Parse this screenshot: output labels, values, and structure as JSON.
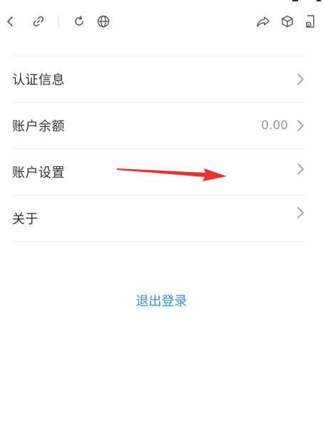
{
  "toolbar": {
    "icons": [
      "back-icon",
      "link-icon",
      "refresh-icon",
      "globe-icon",
      "share-icon",
      "cube-icon",
      "mobile-speaker-icon"
    ]
  },
  "menu": {
    "items": [
      {
        "label": "认证信息",
        "value": ""
      },
      {
        "label": "账户余额",
        "value": "0.00"
      },
      {
        "label": "账户设置",
        "value": ""
      },
      {
        "label": "关于",
        "value": ""
      }
    ]
  },
  "logout": {
    "label": "退出登录"
  },
  "colors": {
    "accent": "#3a8ee6",
    "annotation": "#e8322a",
    "text": "#333333",
    "muted": "#999999",
    "divider": "#f0f0f0"
  }
}
